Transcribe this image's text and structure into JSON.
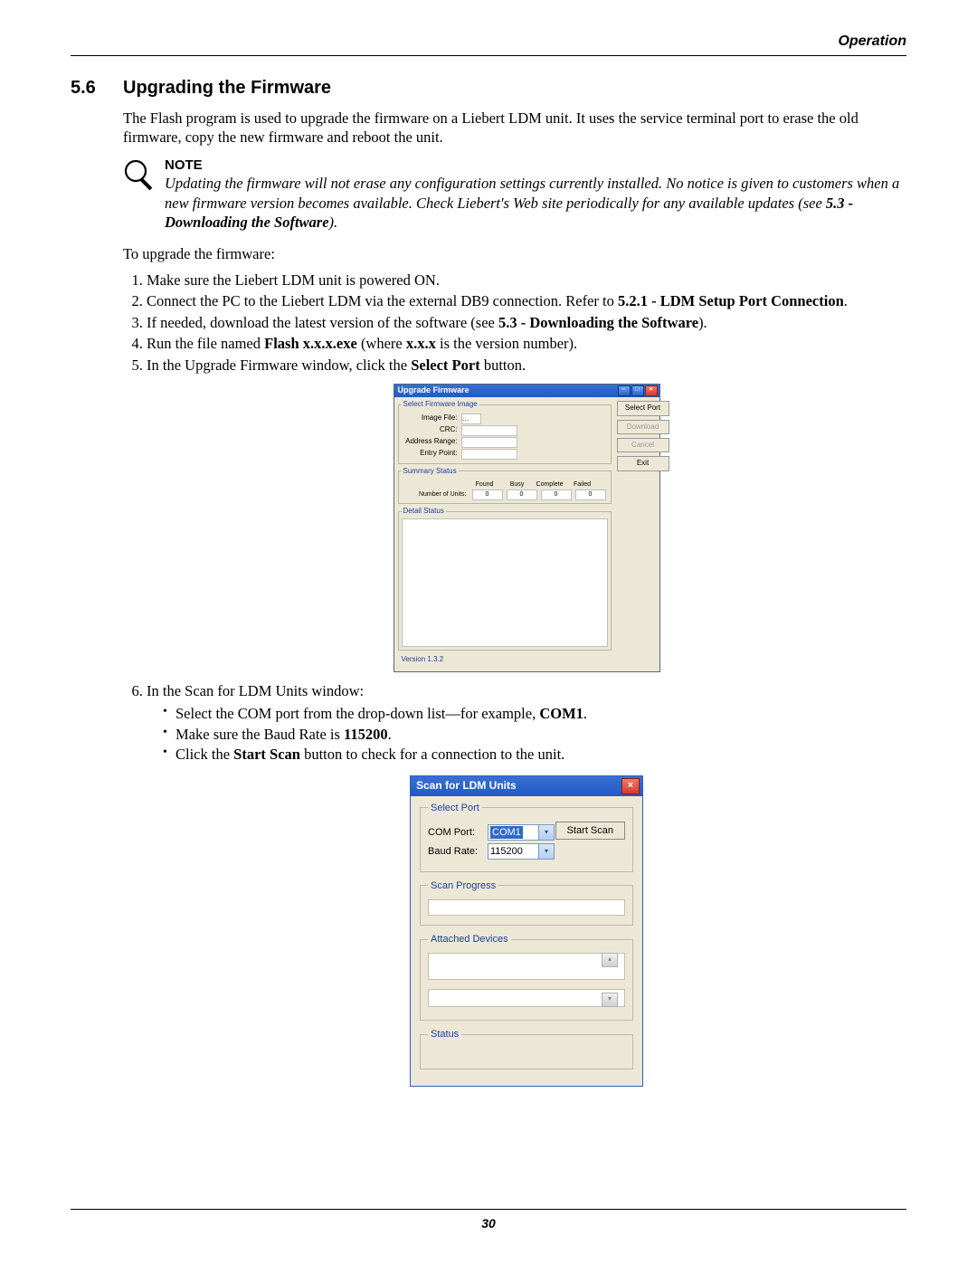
{
  "header": {
    "section_label": "Operation"
  },
  "section": {
    "number": "5.6",
    "title": "Upgrading the Firmware"
  },
  "intro_para": "The Flash program is used to upgrade the firmware on a Liebert LDM unit. It uses the service terminal port to erase the old firmware, copy the new firmware and reboot the unit.",
  "note": {
    "heading": "NOTE",
    "text_before_ref": "Updating the firmware will not erase any configuration settings currently installed. No notice is given to customers when a new firmware version becomes available. Check Liebert's Web site periodically for any available updates (see ",
    "ref": "5.3 - Downloading the Software",
    "text_after_ref": ")."
  },
  "lead_in": "To upgrade the firmware:",
  "steps": {
    "s1": "Make sure the Liebert LDM unit is powered ON.",
    "s2_a": "Connect the PC to the Liebert LDM via the external DB9 connection. Refer to ",
    "s2_b": "5.2.1 - LDM Setup Port Connection",
    "s2_c": ".",
    "s3_a": "If needed, download the latest version of the software (see ",
    "s3_b": "5.3 - Downloading the Software",
    "s3_c": ").",
    "s4_a": "Run the file named ",
    "s4_b": "Flash x.x.x.exe",
    "s4_c": " (where ",
    "s4_d": "x.x.x",
    "s4_e": " is the version number).",
    "s5_a": "In the Upgrade Firmware window, click the ",
    "s5_b": "Select Port",
    "s5_c": " button.",
    "s6": "In the Scan for LDM Units window:",
    "s6_b1_a": "Select the COM port from the drop-down list—for example, ",
    "s6_b1_b": "COM1",
    "s6_b1_c": ".",
    "s6_b2_a": "Make sure the Baud Rate is ",
    "s6_b2_b": "115200",
    "s6_b2_c": ".",
    "s6_b3_a": "Click the ",
    "s6_b3_b": "Start Scan",
    "s6_b3_c": " button to check for a connection to the unit."
  },
  "dialog1": {
    "title": "Upgrade Firmware",
    "fs1_legend": "Select Firmware Image",
    "image_file_label": "Image File:",
    "crc_label": "CRC:",
    "addr_label": "Address Range:",
    "entry_label": "Entry Point:",
    "fs2_legend": "Summary Status",
    "hdr_found": "Found",
    "hdr_busy": "Busy",
    "hdr_complete": "Complete",
    "hdr_failed": "Failed",
    "num_units_label": "Number of Units:",
    "val_found": "0",
    "val_busy": "0",
    "val_complete": "0",
    "val_failed": "0",
    "fs3_legend": "Detail Status",
    "version": "Version 1.3.2",
    "btn_select_port": "Select Port",
    "btn_download": "Download",
    "btn_cancel": "Cancel",
    "btn_exit": "Exit"
  },
  "dialog2": {
    "title": "Scan for LDM Units",
    "fs1_legend": "Select Port",
    "com_label": "COM Port:",
    "com_value": "COM1",
    "baud_label": "Baud Rate:",
    "baud_value": "115200",
    "btn_start_scan": "Start Scan",
    "fs2_legend": "Scan Progress",
    "fs3_legend": "Attached Devices",
    "fs4_legend": "Status"
  },
  "page_number": "30"
}
